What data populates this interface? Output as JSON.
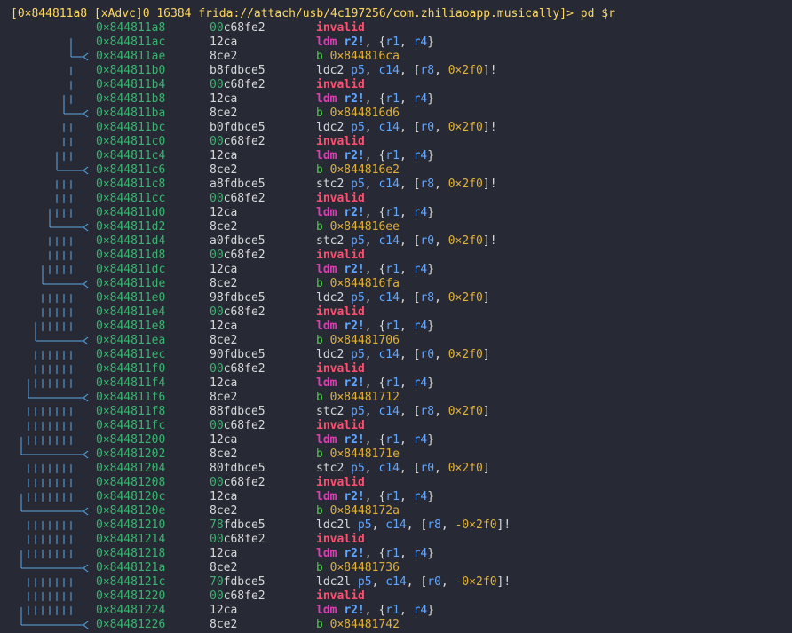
{
  "prompt": "[0×844811a8 [xAdvc]0 16384 frida://attach/usb/4c197256/com.zhiliaoapp.musically]> pd $r",
  "colors": {
    "background": "#272a34",
    "prompt": "#ffd75f",
    "address": "#3cb371",
    "bytes": "#d8d8d8",
    "invalid": "#ff4f6f",
    "ldm": "#e23ab8",
    "register": "#62a6ff",
    "branch": "#4ec94e",
    "number": "#e0b03a",
    "graph": "#5fa8e8"
  },
  "rows": [
    {
      "addr": "0×844811a8",
      "hi": "00",
      "bytes": "c68fe2",
      "kind": "invalid",
      "text": "invalid"
    },
    {
      "addr": "0×844811ac",
      "hi": "",
      "bytes": "12ca",
      "kind": "ldm",
      "text": "ldm r2!, {r1, r4}"
    },
    {
      "addr": "0×844811ae",
      "hi": "",
      "bytes": "8ce2",
      "kind": "b",
      "text": "b 0×844816ca"
    },
    {
      "addr": "0×844811b0",
      "hi": "",
      "bytes": "b8fdbce5",
      "kind": "cop",
      "text": "ldc2 p5, c14, [r8, 0×2f0]!"
    },
    {
      "addr": "0×844811b4",
      "hi": "00",
      "bytes": "c68fe2",
      "kind": "invalid",
      "text": "invalid"
    },
    {
      "addr": "0×844811b8",
      "hi": "",
      "bytes": "12ca",
      "kind": "ldm",
      "text": "ldm r2!, {r1, r4}"
    },
    {
      "addr": "0×844811ba",
      "hi": "",
      "bytes": "8ce2",
      "kind": "b",
      "text": "b 0×844816d6"
    },
    {
      "addr": "0×844811bc",
      "hi": "",
      "bytes": "b0fdbce5",
      "kind": "cop",
      "text": "ldc2 p5, c14, [r0, 0×2f0]!"
    },
    {
      "addr": "0×844811c0",
      "hi": "00",
      "bytes": "c68fe2",
      "kind": "invalid",
      "text": "invalid"
    },
    {
      "addr": "0×844811c4",
      "hi": "",
      "bytes": "12ca",
      "kind": "ldm",
      "text": "ldm r2!, {r1, r4}"
    },
    {
      "addr": "0×844811c6",
      "hi": "",
      "bytes": "8ce2",
      "kind": "b",
      "text": "b 0×844816e2"
    },
    {
      "addr": "0×844811c8",
      "hi": "",
      "bytes": "a8fdbce5",
      "kind": "cop",
      "text": "stc2 p5, c14, [r8, 0×2f0]!"
    },
    {
      "addr": "0×844811cc",
      "hi": "00",
      "bytes": "c68fe2",
      "kind": "invalid",
      "text": "invalid"
    },
    {
      "addr": "0×844811d0",
      "hi": "",
      "bytes": "12ca",
      "kind": "ldm",
      "text": "ldm r2!, {r1, r4}"
    },
    {
      "addr": "0×844811d2",
      "hi": "",
      "bytes": "8ce2",
      "kind": "b",
      "text": "b 0×844816ee"
    },
    {
      "addr": "0×844811d4",
      "hi": "",
      "bytes": "a0fdbce5",
      "kind": "cop",
      "text": "stc2 p5, c14, [r0, 0×2f0]!"
    },
    {
      "addr": "0×844811d8",
      "hi": "00",
      "bytes": "c68fe2",
      "kind": "invalid",
      "text": "invalid"
    },
    {
      "addr": "0×844811dc",
      "hi": "",
      "bytes": "12ca",
      "kind": "ldm",
      "text": "ldm r2!, {r1, r4}"
    },
    {
      "addr": "0×844811de",
      "hi": "",
      "bytes": "8ce2",
      "kind": "b",
      "text": "b 0×844816fa"
    },
    {
      "addr": "0×844811e0",
      "hi": "",
      "bytes": "98fdbce5",
      "kind": "cop",
      "text": "ldc2 p5, c14, [r8, 0×2f0]"
    },
    {
      "addr": "0×844811e4",
      "hi": "00",
      "bytes": "c68fe2",
      "kind": "invalid",
      "text": "invalid"
    },
    {
      "addr": "0×844811e8",
      "hi": "",
      "bytes": "12ca",
      "kind": "ldm",
      "text": "ldm r2!, {r1, r4}"
    },
    {
      "addr": "0×844811ea",
      "hi": "",
      "bytes": "8ce2",
      "kind": "b",
      "text": "b 0×84481706"
    },
    {
      "addr": "0×844811ec",
      "hi": "",
      "bytes": "90fdbce5",
      "kind": "cop",
      "text": "ldc2 p5, c14, [r0, 0×2f0]"
    },
    {
      "addr": "0×844811f0",
      "hi": "00",
      "bytes": "c68fe2",
      "kind": "invalid",
      "text": "invalid"
    },
    {
      "addr": "0×844811f4",
      "hi": "",
      "bytes": "12ca",
      "kind": "ldm",
      "text": "ldm r2!, {r1, r4}"
    },
    {
      "addr": "0×844811f6",
      "hi": "",
      "bytes": "8ce2",
      "kind": "b",
      "text": "b 0×84481712"
    },
    {
      "addr": "0×844811f8",
      "hi": "",
      "bytes": "88fdbce5",
      "kind": "cop",
      "text": "stc2 p5, c14, [r8, 0×2f0]"
    },
    {
      "addr": "0×844811fc",
      "hi": "00",
      "bytes": "c68fe2",
      "kind": "invalid",
      "text": "invalid"
    },
    {
      "addr": "0×84481200",
      "hi": "",
      "bytes": "12ca",
      "kind": "ldm",
      "text": "ldm r2!, {r1, r4}"
    },
    {
      "addr": "0×84481202",
      "hi": "",
      "bytes": "8ce2",
      "kind": "b",
      "text": "b 0×8448171e"
    },
    {
      "addr": "0×84481204",
      "hi": "",
      "bytes": "80fdbce5",
      "kind": "cop",
      "text": "stc2 p5, c14, [r0, 0×2f0]"
    },
    {
      "addr": "0×84481208",
      "hi": "00",
      "bytes": "c68fe2",
      "kind": "invalid",
      "text": "invalid"
    },
    {
      "addr": "0×8448120c",
      "hi": "",
      "bytes": "12ca",
      "kind": "ldm",
      "text": "ldm r2!, {r1, r4}"
    },
    {
      "addr": "0×8448120e",
      "hi": "",
      "bytes": "8ce2",
      "kind": "b",
      "text": "b 0×8448172a"
    },
    {
      "addr": "0×84481210",
      "hi": "78",
      "bytes": "fdbce5",
      "kind": "cop",
      "text": "ldc2l p5, c14, [r8, -0×2f0]!"
    },
    {
      "addr": "0×84481214",
      "hi": "00",
      "bytes": "c68fe2",
      "kind": "invalid",
      "text": "invalid"
    },
    {
      "addr": "0×84481218",
      "hi": "",
      "bytes": "12ca",
      "kind": "ldm",
      "text": "ldm r2!, {r1, r4}"
    },
    {
      "addr": "0×8448121a",
      "hi": "",
      "bytes": "8ce2",
      "kind": "b",
      "text": "b 0×84481736"
    },
    {
      "addr": "0×8448121c",
      "hi": "70",
      "bytes": "fdbce5",
      "kind": "cop",
      "text": "ldc2l p5, c14, [r0, -0×2f0]!"
    },
    {
      "addr": "0×84481220",
      "hi": "00",
      "bytes": "c68fe2",
      "kind": "invalid",
      "text": "invalid"
    },
    {
      "addr": "0×84481224",
      "hi": "",
      "bytes": "12ca",
      "kind": "ldm",
      "text": "ldm r2!, {r1, r4}"
    },
    {
      "addr": "0×84481226",
      "hi": "",
      "bytes": "8ce2",
      "kind": "b",
      "text": "b 0×84481742"
    }
  ]
}
